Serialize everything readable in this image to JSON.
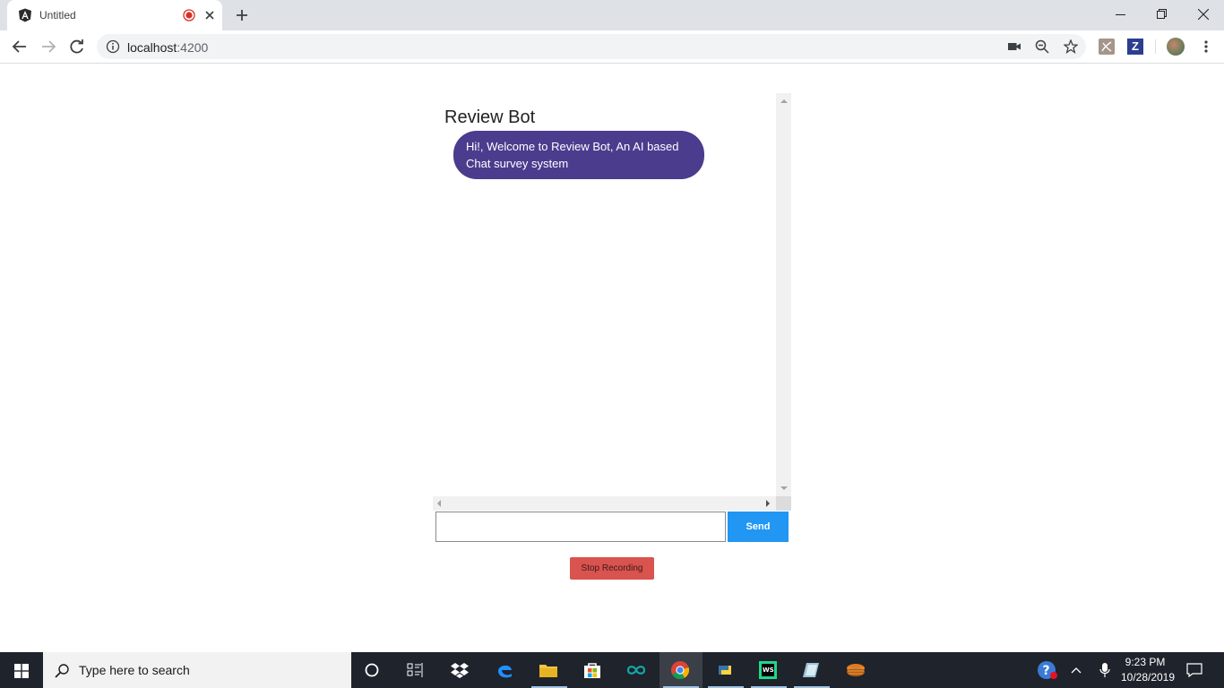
{
  "browser": {
    "tab_title": "Untitled",
    "url_host": "localhost",
    "url_port": ":4200"
  },
  "app": {
    "title": "Review Bot",
    "bot_message": "Hi!, Welcome to Review Bot, An AI based Chat survey system",
    "input_value": "",
    "send_label": "Send",
    "stop_label": "Stop Recording",
    "colors": {
      "bubble": "#4b3c8e",
      "send": "#2196f3",
      "stop": "#d9534f"
    }
  },
  "taskbar": {
    "search_placeholder": "Type here to search",
    "time": "9:23 PM",
    "date": "10/28/2019"
  }
}
